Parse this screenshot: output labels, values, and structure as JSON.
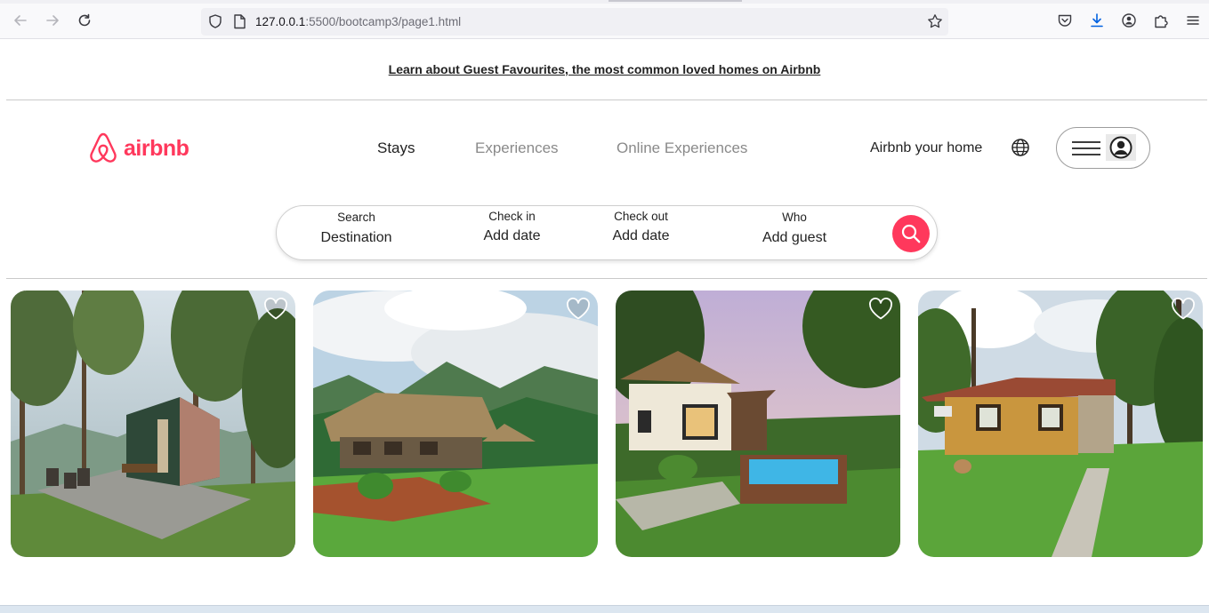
{
  "browser": {
    "url_host": "127.0.0.1",
    "url_path": ":5500/bootcamp3/page1.html"
  },
  "banner": {
    "text": "Learn about Guest Favourites, the most common loved homes on Airbnb"
  },
  "header": {
    "logo_text": "airbnb",
    "brand_color": "#ff385c",
    "tabs": [
      {
        "label": "Stays",
        "active": true
      },
      {
        "label": "Experiences",
        "active": false
      },
      {
        "label": "Online Experiences",
        "active": false
      }
    ],
    "host_link": "Airbnb your home"
  },
  "search": {
    "fields": [
      {
        "label": "Search",
        "value": "Destination"
      },
      {
        "label": "Check in",
        "value": "Add date"
      },
      {
        "label": "Check out",
        "value": "Add date"
      },
      {
        "label": "Who",
        "value": "Add guest"
      }
    ]
  },
  "listings": [
    {
      "image": "green-cabin-on-concrete-deck-in-pine-forest",
      "favorite": false
    },
    {
      "image": "thatched-hut-below-misty-mountains",
      "favorite": false
    },
    {
      "image": "thatched-cottage-with-plunge-pool",
      "favorite": false
    },
    {
      "image": "wooden-cabin-on-lawn-with-stone-path",
      "favorite": false
    }
  ]
}
